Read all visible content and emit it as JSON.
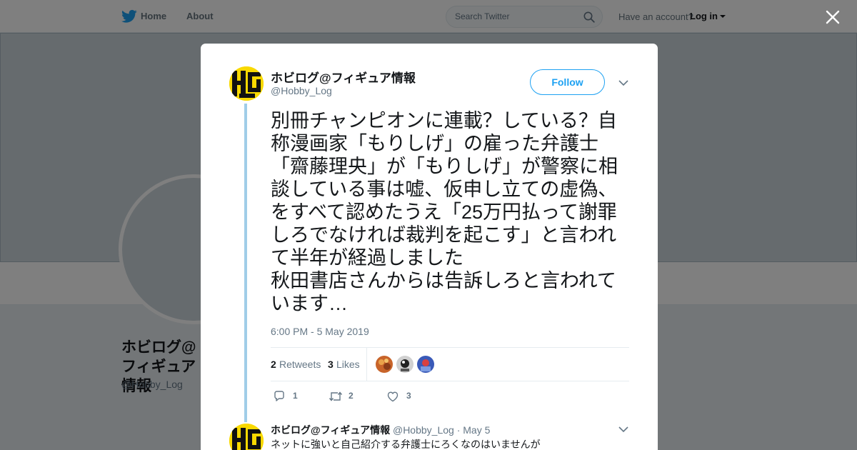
{
  "nav": {
    "home_label": "Home",
    "about_label": "About",
    "search_placeholder": "Search Twitter",
    "have_account_text": "Have an account?",
    "login_label": "Log in"
  },
  "background_profile": {
    "name": "ホビログ@フィギュア情報",
    "handle": "@Hobby_Log"
  },
  "tweet": {
    "display_name": "ホビログ@フィギュア情報",
    "screen_name": "@Hobby_Log",
    "follow_label": "Follow",
    "text": "別冊チャンピオンに連載？している？自称漫画家「もりしげ」の雇った弁護士「齋藤理央」が「もりしげ」が警察に相談している事は嘘、仮申し立ての虚偽、をすべて認めたうえ「25万円払って謝罪しろでなければ裁判を起こす」と言われて半年が経過しました\n秋田書店さんからは告訴しろと言われています…",
    "timestamp": "6:00 PM - 5 May 2019",
    "retweets_count": "2",
    "retweets_label": "Retweets",
    "likes_count": "3",
    "likes_label": "Likes",
    "reply_count": "1",
    "retweet_action_count": "2",
    "like_action_count": "3"
  },
  "reply": {
    "name": "ホビログ@フィギュア情報",
    "meta": " @Hobby_Log · May 5",
    "text": "ネットに強いと自己紹介する弁護士にろくなのはいませんが"
  },
  "colors": {
    "twitter_blue": "#1da1f2",
    "thread_line": "#a0cde8",
    "avatar_yellow": "#f9d900",
    "text_primary": "#14171a",
    "text_secondary": "#657786"
  }
}
